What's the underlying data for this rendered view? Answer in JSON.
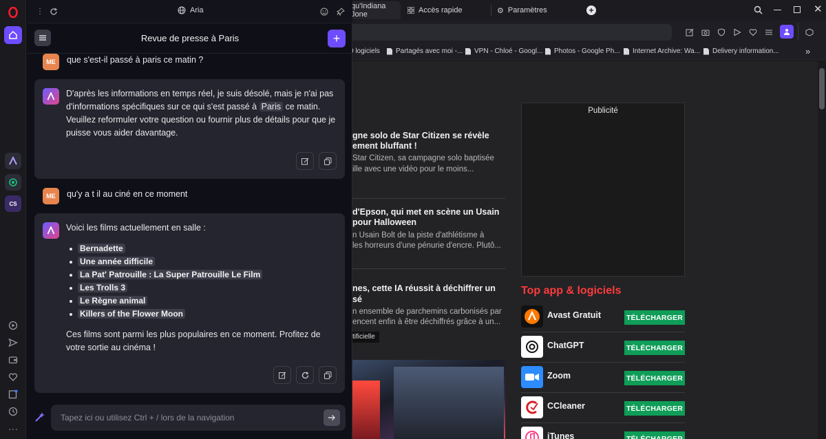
{
  "browser": {
    "tabs": [
      {
        "label": "qu'Indiana Jone"
      },
      {
        "label": "Accès rapide"
      },
      {
        "label": "Paramètres"
      }
    ],
    "bookmarks": [
      {
        "label": "0 logiciels"
      },
      {
        "label": "Partagés avec moi -..."
      },
      {
        "label": "VPN - Chloé - Googl..."
      },
      {
        "label": "Photos - Google Ph..."
      },
      {
        "label": "Internet Archive: Wa..."
      },
      {
        "label": "Delivery information..."
      }
    ]
  },
  "aria": {
    "top_title": "Aria",
    "chat_title": "Revue de presse à Paris",
    "avatar_label": "ME",
    "messages": {
      "user1": "que s'est-il passé à paris ce matin ?",
      "reply1_a": "D'après les informations en temps réel, je suis désolé, mais je n'ai pas d'informations spécifiques sur ce qui s'est passé à",
      "reply1_hl": "Paris",
      "reply1_b": "ce matin. Veuillez reformuler votre question ou fournir plus de détails pour que je puisse vous aider davantage.",
      "user2": "qu'y a t il au ciné en ce moment",
      "reply2_intro": "Voici les films actuellement en salle :",
      "films": [
        "Bernadette",
        "Une année difficile",
        "La Pat' Patrouille : La Super Patrouille Le Film",
        "Les Trolls 3",
        "Le Règne animal",
        "Killers of the Flower Moon"
      ],
      "reply2_outro": "Ces films sont parmi les plus populaires en ce moment. Profitez de votre sortie au cinéma !"
    },
    "input_placeholder": "Tapez ici ou utilisez Ctrl + / lors de la navigation"
  },
  "page": {
    "articles": [
      {
        "title1": "gne solo de Star Citizen se révèle",
        "title2": "ement bluffant !",
        "desc1": "Star Citizen, sa campagne solo baptisée",
        "desc2": "ille avec une vidéo pour le moins..."
      },
      {
        "title1": "d'Epson, qui met en scène un Usain",
        "title2": "pour Halloween",
        "desc1": "n Usain Bolt de la piste d'athlétisme à",
        "desc2": "les horreurs d'une pénurie d'encre. Plutô..."
      },
      {
        "title1": "nes, cette IA réussit à déchiffrer un",
        "title2": "sé",
        "desc1": "n ensemble de parchemins carbonisés par",
        "desc2": "encent enfin à être déchiffrés grâce à un..."
      }
    ],
    "tag": "tificielle",
    "ad_label": "Publicité",
    "top_apps_title": "Top app & logiciels",
    "download_label": "TÉLÉCHARGER",
    "apps": [
      {
        "name": "Avast Gratuit"
      },
      {
        "name": "ChatGPT"
      },
      {
        "name": "Zoom"
      },
      {
        "name": "CCleaner"
      },
      {
        "name": "iTunes"
      }
    ]
  },
  "colors": {
    "accent": "#6e4cff",
    "download": "#0f9d58",
    "top_apps_title": "#ff3b3b",
    "opera_red": "#ff1b2d"
  }
}
